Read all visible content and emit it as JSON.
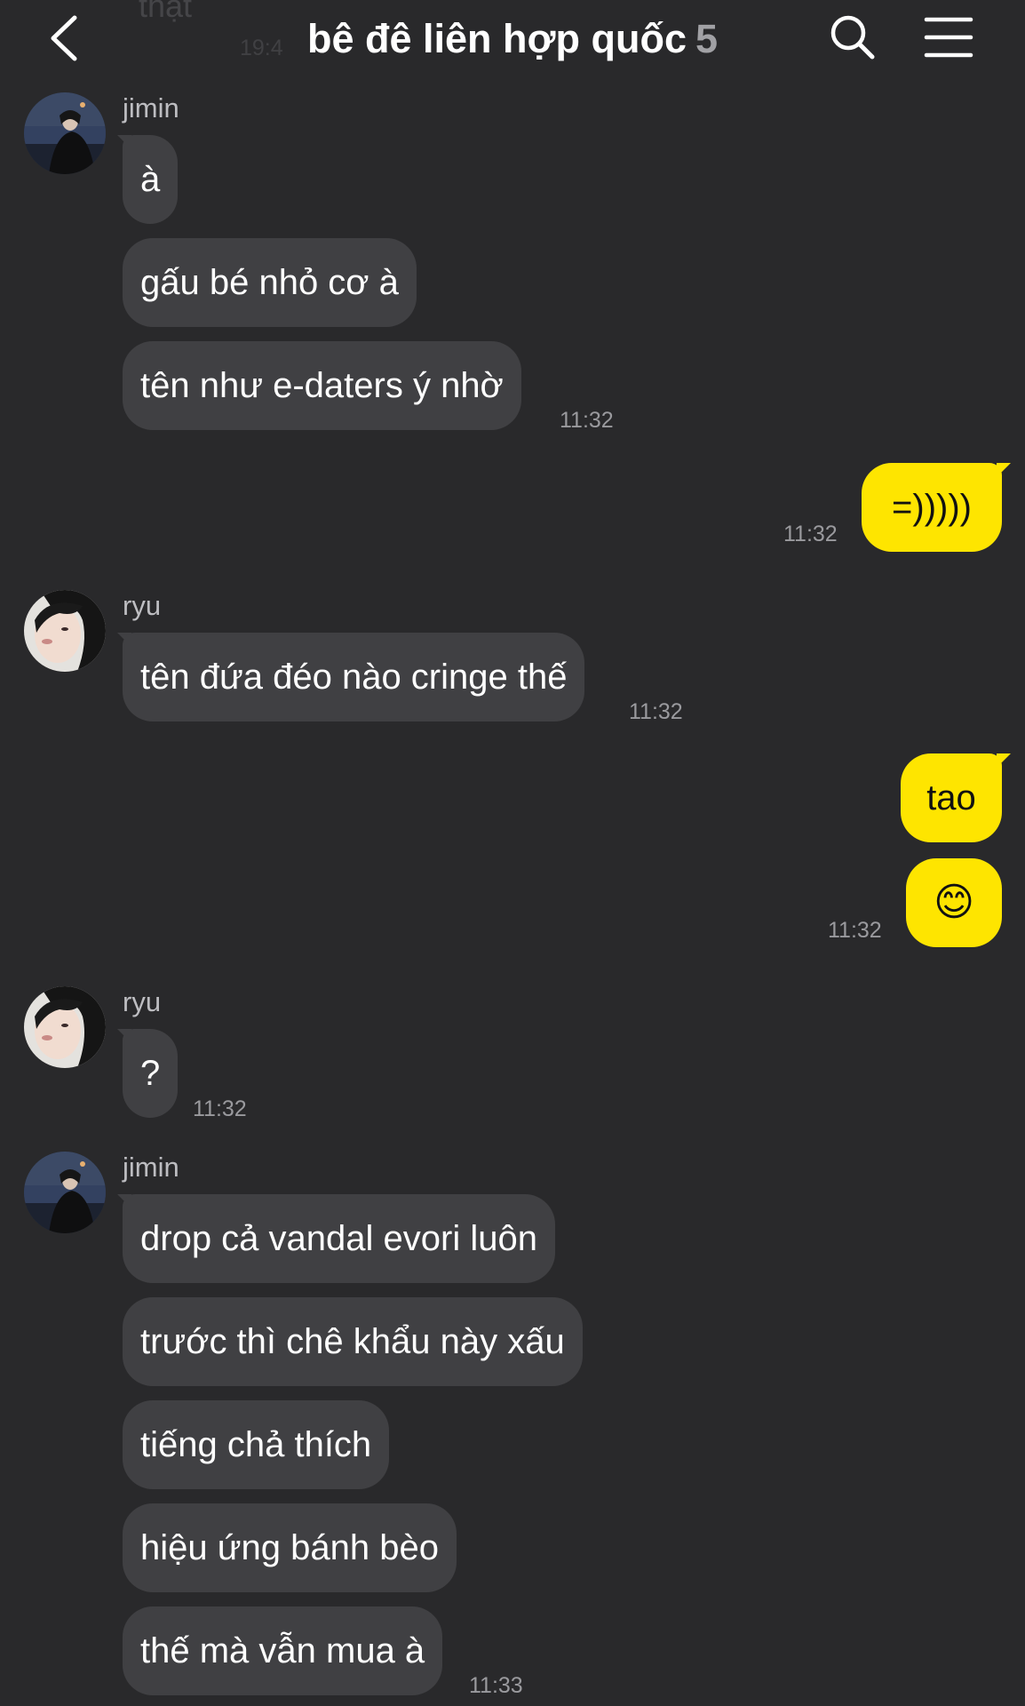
{
  "colors": {
    "background": "#29292b",
    "incoming_bubble": "#404043",
    "outgoing_bubble": "#fee500",
    "timestamp": "#9a9a9e",
    "sender_name": "#bdbdc1"
  },
  "header": {
    "back_icon": "chevron-left-icon",
    "title": "bê đê liên hợp quốc",
    "member_count": "5",
    "search_icon": "search-icon",
    "menu_icon": "hamburger-menu-icon",
    "scrolled_preview_text": "thật",
    "scrolled_preview_time": "19:4"
  },
  "messages": [
    {
      "direction": "incoming",
      "sender": "jimin",
      "lines": [
        "à",
        "gấu bé nhỏ cơ à",
        "tên như e-daters ý nhờ"
      ],
      "time": "11:32"
    },
    {
      "direction": "outgoing",
      "lines": [
        "=)))))"
      ],
      "time": "11:32"
    },
    {
      "direction": "incoming",
      "sender": "ryu",
      "lines": [
        "tên đứa đéo nào cringe thế"
      ],
      "time": "11:32"
    },
    {
      "direction": "outgoing",
      "lines": [
        "tao",
        "😊"
      ],
      "time": "11:32"
    },
    {
      "direction": "incoming",
      "sender": "ryu",
      "lines": [
        "?"
      ],
      "time": "11:32"
    },
    {
      "direction": "incoming",
      "sender": "jimin",
      "lines": [
        "drop cả vandal evori luôn",
        "trước thì chê khẩu này xấu",
        "tiếng chả thích",
        "hiệu ứng bánh bèo",
        "thế mà vẫn mua à"
      ],
      "time": "11:33"
    }
  ]
}
